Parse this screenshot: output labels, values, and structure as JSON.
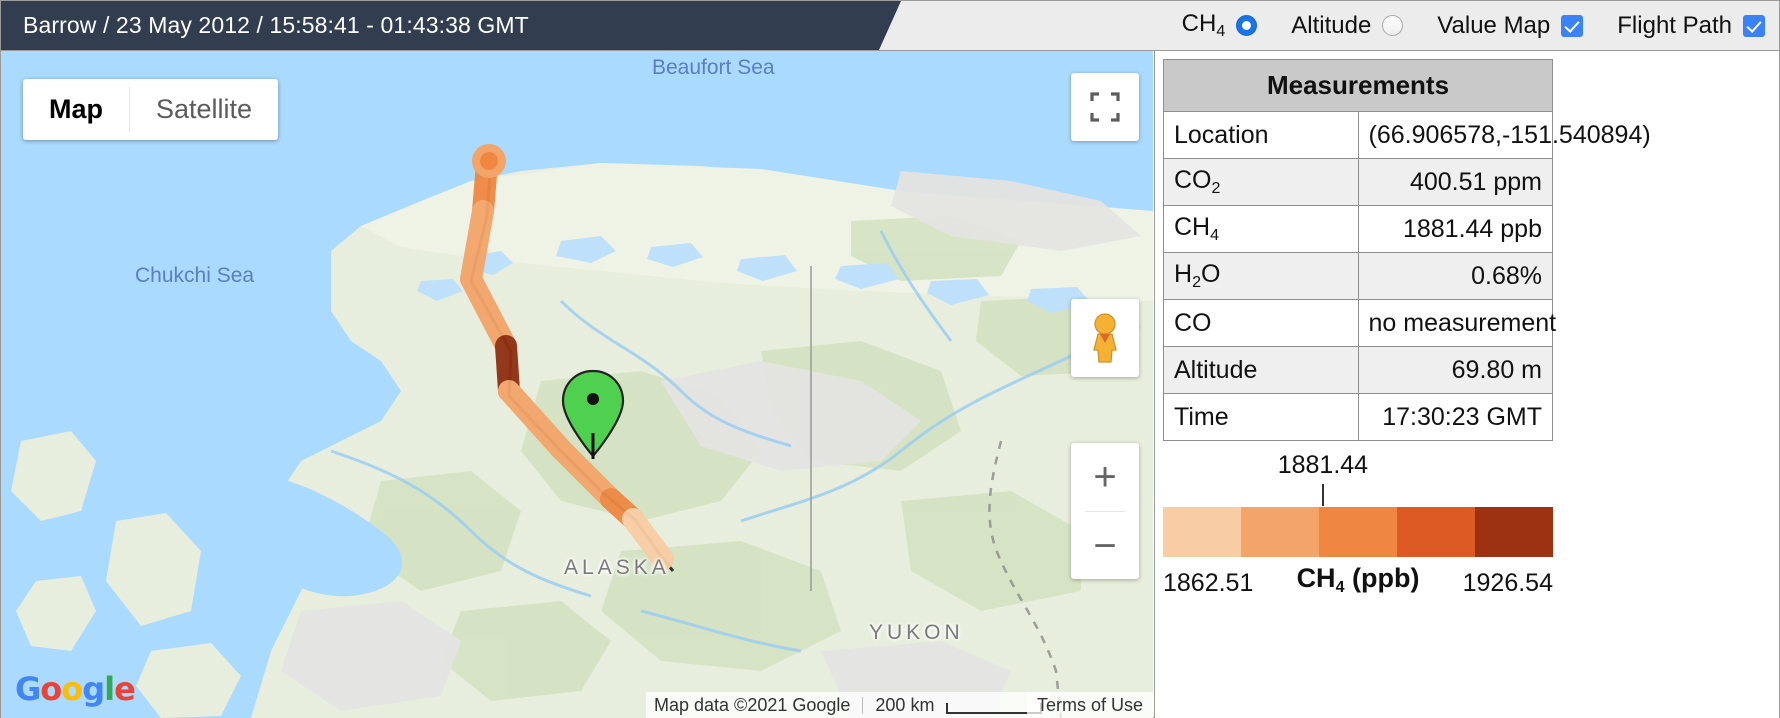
{
  "header": {
    "title": "Barrow / 23 May 2012 / 15:58:41 - 01:43:38 GMT",
    "controls": {
      "ch4_label_main": "CH",
      "ch4_label_sub": "4",
      "ch4_selected": true,
      "altitude_label": "Altitude",
      "altitude_selected": false,
      "value_map_label": "Value Map",
      "value_map_checked": true,
      "flight_path_label": "Flight Path",
      "flight_path_checked": true
    }
  },
  "map": {
    "map_type": {
      "map_label": "Map",
      "satellite_label": "Satellite",
      "active": "Map"
    },
    "zoom_in_label": "+",
    "zoom_out_label": "−",
    "labels": {
      "beaufort_sea": "Beaufort Sea",
      "chukchi_sea": "Chukchi Sea",
      "alaska": "ALASKA",
      "yukon": "YUKON"
    },
    "attribution": "Map data ©2021 Google",
    "scale_label": "200 km",
    "terms": "Terms of Use",
    "logo": "Google"
  },
  "measurements": {
    "title": "Measurements",
    "rows": [
      {
        "key": "Location",
        "value": "(66.906578,-151.540894)"
      },
      {
        "key": "CO",
        "key_sub": "2",
        "value": "400.51 ppm"
      },
      {
        "key": "CH",
        "key_sub": "4",
        "value": "1881.44 ppb"
      },
      {
        "key": "H",
        "key_sub": "2",
        "key_tail": "O",
        "value": "0.68%"
      },
      {
        "key": "CO",
        "value": "no measurement"
      },
      {
        "key": "Altitude",
        "value": "69.80 m"
      },
      {
        "key": "Time",
        "value": "17:30:23 GMT"
      }
    ]
  },
  "colorbar": {
    "tick_value": "1881.44",
    "tick_position_pct": 41,
    "min_label": "1862.51",
    "max_label": "1926.54",
    "caption_main": "CH",
    "caption_sub": "4",
    "caption_tail": " (ppb)",
    "colors": [
      "#f8cda4",
      "#f3a469",
      "#ef8742",
      "#dd5a24",
      "#9c3211"
    ]
  },
  "colors": {
    "title_bg": "#323e50",
    "topbar_bg": "#ececec",
    "accent_blue": "#3b82f6",
    "radio_blue": "#1a73e8",
    "water": "#aadaff",
    "land": "#e8eedd",
    "marker_green": "#4fd14f"
  }
}
